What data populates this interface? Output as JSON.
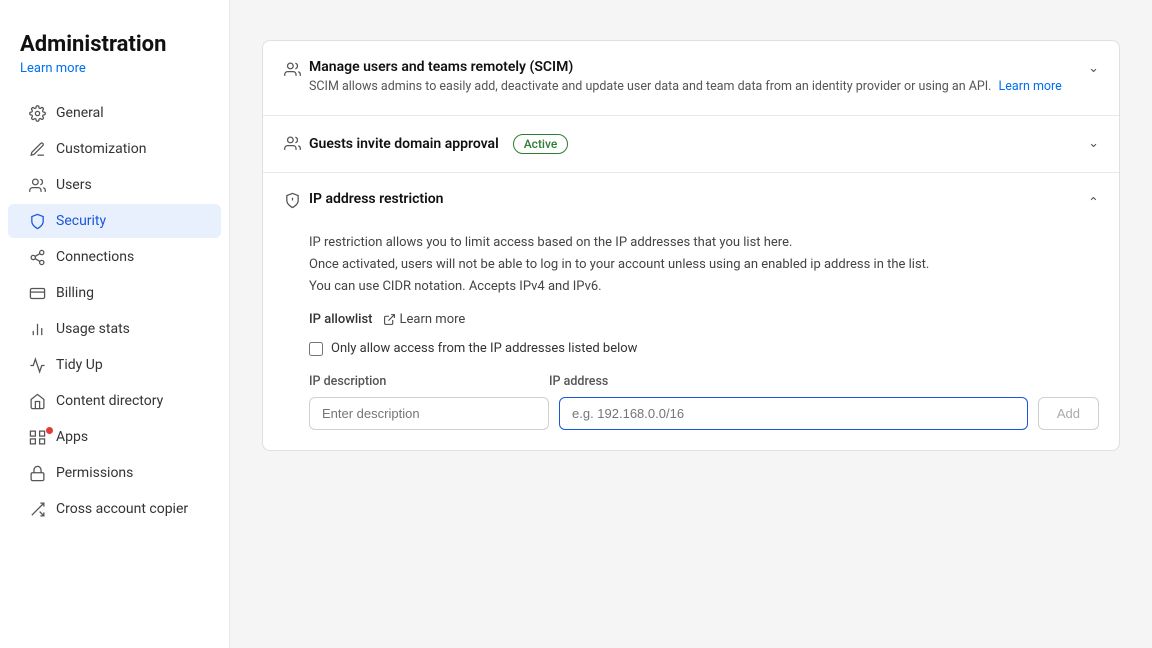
{
  "sidebar": {
    "title": "Administration",
    "learn_more": "Learn more",
    "items": [
      {
        "id": "general",
        "label": "General",
        "icon": "general-icon",
        "active": false
      },
      {
        "id": "customization",
        "label": "Customization",
        "icon": "customization-icon",
        "active": false
      },
      {
        "id": "users",
        "label": "Users",
        "icon": "users-icon",
        "active": false
      },
      {
        "id": "security",
        "label": "Security",
        "icon": "security-icon",
        "active": true
      },
      {
        "id": "connections",
        "label": "Connections",
        "icon": "connections-icon",
        "active": false
      },
      {
        "id": "billing",
        "label": "Billing",
        "icon": "billing-icon",
        "active": false
      },
      {
        "id": "usage-stats",
        "label": "Usage stats",
        "icon": "usage-stats-icon",
        "active": false
      },
      {
        "id": "tidy-up",
        "label": "Tidy Up",
        "icon": "tidy-up-icon",
        "active": false
      },
      {
        "id": "content-directory",
        "label": "Content directory",
        "icon": "content-directory-icon",
        "active": false
      },
      {
        "id": "apps",
        "label": "Apps",
        "icon": "apps-icon",
        "active": false,
        "badge": true
      },
      {
        "id": "permissions",
        "label": "Permissions",
        "icon": "permissions-icon",
        "active": false
      },
      {
        "id": "cross-account-copier",
        "label": "Cross account copier",
        "icon": "cross-account-copier-icon",
        "active": false
      }
    ]
  },
  "main": {
    "sections": [
      {
        "id": "scim",
        "title": "Manage users and teams remotely (SCIM)",
        "subtitle": "SCIM allows admins to easily add, deactivate and update user data and team data from an identity provider or using an API.",
        "learn_more_link": "Learn more",
        "expanded": false,
        "icon": "scim-icon"
      },
      {
        "id": "guests-domain",
        "title": "Guests invite domain approval",
        "subtitle": "",
        "badge": "Active",
        "expanded": false,
        "icon": "guests-icon"
      },
      {
        "id": "ip-restriction",
        "title": "IP address restriction",
        "subtitle": "",
        "expanded": true,
        "icon": "ip-icon",
        "body": {
          "description_line1": "IP restriction allows you to limit access based on the IP addresses that you list here.",
          "description_line2": "Once activated, users will not be able to log in to your account unless using an enabled ip address in the list.",
          "description_line3": "You can use CIDR notation. Accepts IPv4 and IPv6.",
          "allowlist_label": "IP allowlist",
          "allowlist_link": "Learn more",
          "checkbox_label": "Only allow access from the IP addresses listed below",
          "col_desc": "IP description",
          "col_addr": "IP address",
          "input_desc_placeholder": "Enter description",
          "input_addr_placeholder": "e.g. 192.168.0.0/16",
          "add_button": "Add"
        }
      }
    ]
  }
}
